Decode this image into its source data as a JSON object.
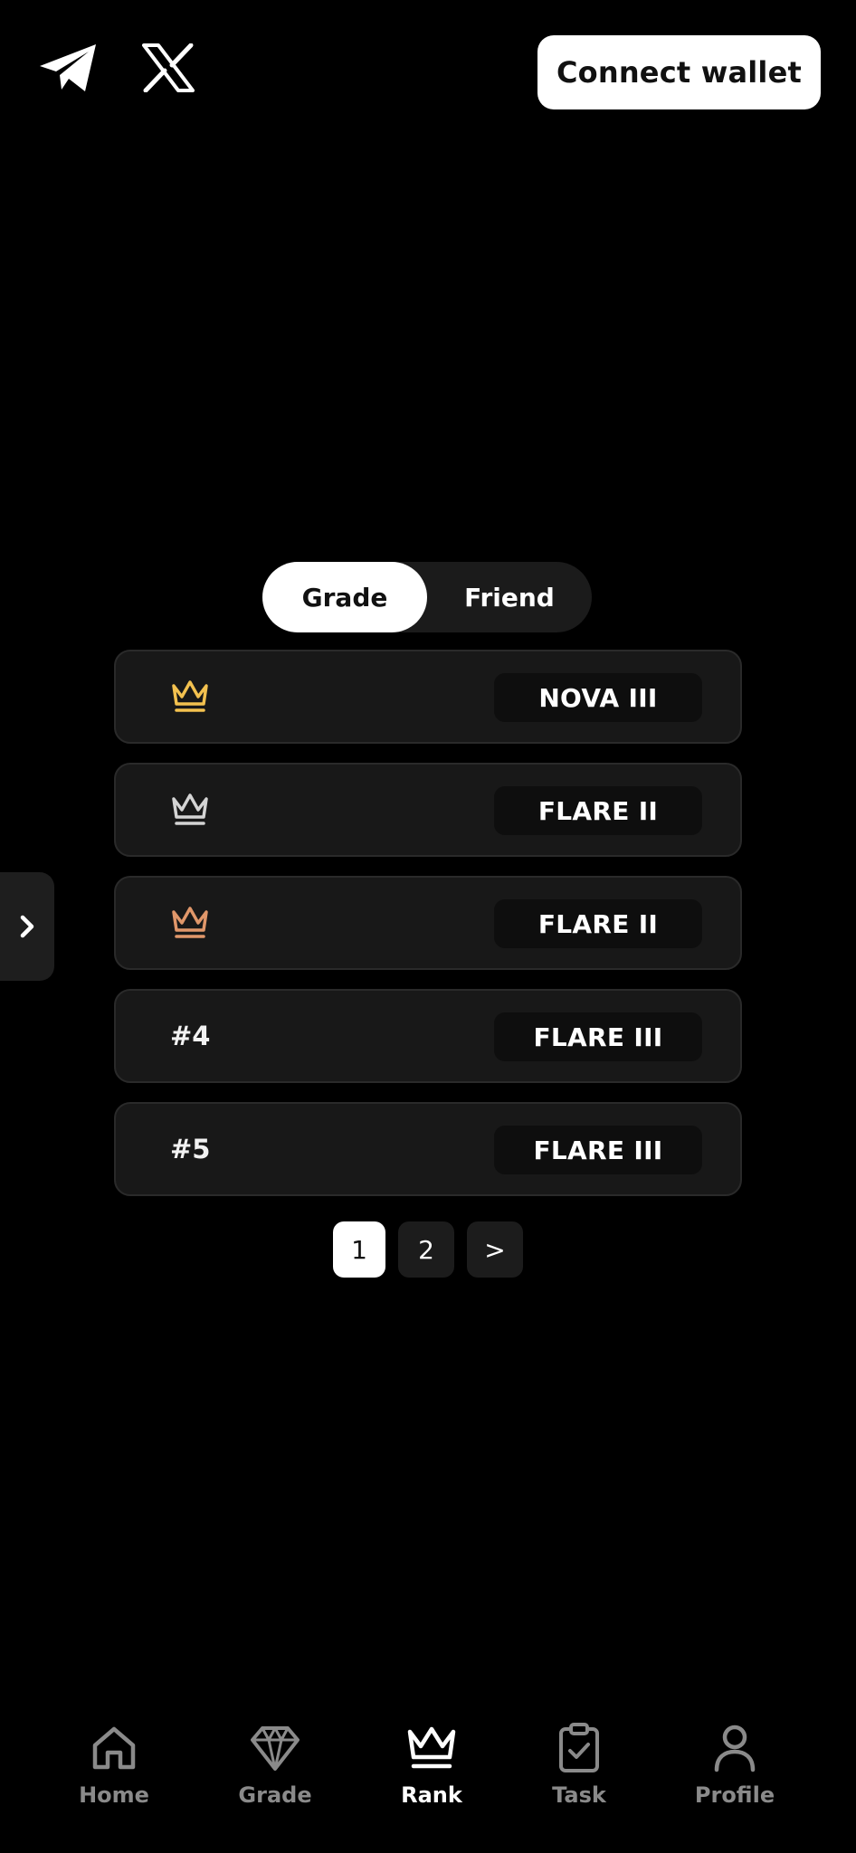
{
  "header": {
    "social": [
      {
        "name": "telegram-icon"
      },
      {
        "name": "x-icon"
      }
    ],
    "connect_wallet_label": "Connect wallet"
  },
  "toggle": {
    "options": [
      "Grade",
      "Friend"
    ],
    "active": "Grade"
  },
  "ranks": [
    {
      "position": "",
      "icon": "crown-gold-icon",
      "grade": "NOVA III"
    },
    {
      "position": "",
      "icon": "crown-silver-icon",
      "grade": "FLARE II"
    },
    {
      "position": "",
      "icon": "crown-bronze-icon",
      "grade": "FLARE II"
    },
    {
      "position": "#4",
      "icon": "",
      "grade": "FLARE III"
    },
    {
      "position": "#5",
      "icon": "",
      "grade": "FLARE III"
    }
  ],
  "pagination": {
    "pages": [
      "1",
      "2"
    ],
    "next_label": ">",
    "current": "1"
  },
  "side_handle_icon": "chevron-right-icon",
  "nav": {
    "items": [
      {
        "label": "Home",
        "icon": "home-icon"
      },
      {
        "label": "Grade",
        "icon": "diamond-icon"
      },
      {
        "label": "Rank",
        "icon": "crown-icon"
      },
      {
        "label": "Task",
        "icon": "clipboard-check-icon"
      },
      {
        "label": "Profile",
        "icon": "user-icon"
      }
    ],
    "active": "Rank"
  },
  "colors": {
    "background": "#000000",
    "card": "#181818",
    "gold": "#f3c14f",
    "silver": "#d4d4d4",
    "bronze": "#e0976a",
    "muted": "#8a8a8a"
  }
}
